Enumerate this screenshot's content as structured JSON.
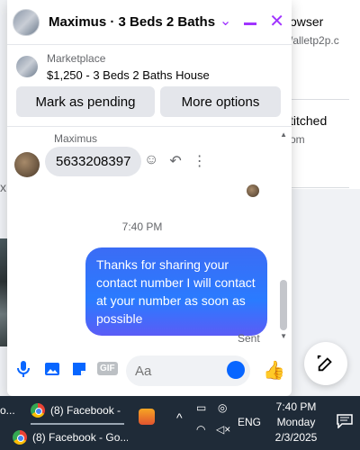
{
  "background": {
    "right_texts": [
      "owser",
      "/alletp2p.c",
      "titched",
      "om"
    ],
    "left_x": "x"
  },
  "chat": {
    "title": "Maximus · 3 Beds 2 Baths ...",
    "marketplace_label": "Marketplace",
    "listing": "$1,250 - 3 Beds 2 Baths House",
    "mark_pending_label": "Mark as pending",
    "more_options_label": "More options",
    "sender_name": "Maximus",
    "incoming_message": "5633208397",
    "timestamp": "7:40 PM",
    "outgoing_message": "Thanks for sharing your contact number I will contact at your number as soon as possible",
    "status": "Sent",
    "input_placeholder": "Aa",
    "gif_label": "GIF"
  },
  "taskbar": {
    "tab1": "(8) Facebook - ...",
    "tab2": "(8) Facebook - Go...",
    "language": "ENG",
    "clock_time": "7:40 PM",
    "clock_day": "Monday",
    "clock_date": "2/3/2025",
    "left_edge_text": "o..."
  },
  "colors": {
    "accent": "#a033ff",
    "messenger_blue": "#0866ff",
    "taskbar": "#1f2b38"
  }
}
